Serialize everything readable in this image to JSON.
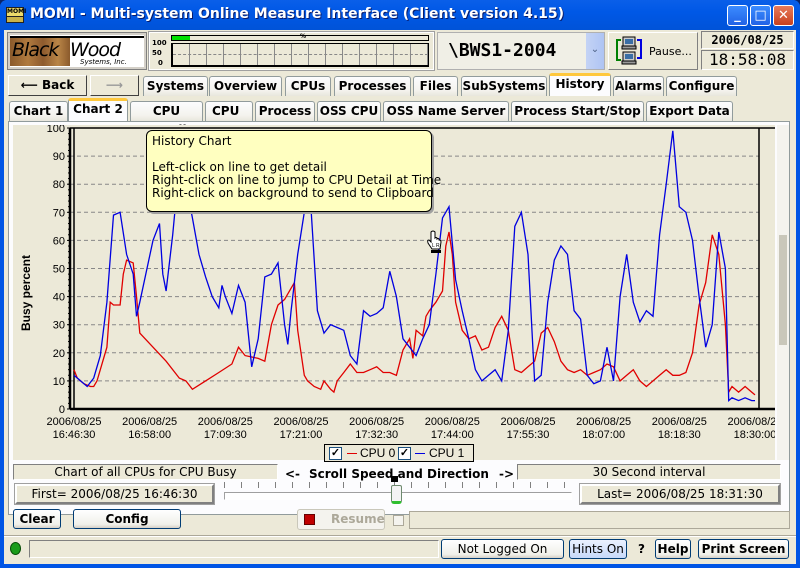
{
  "window": {
    "title": "MOMI - Multi-system Online Measure Interface (Client version 4.15)",
    "icon_label": "MOMI",
    "controls": [
      "minimize",
      "maximize",
      "close"
    ]
  },
  "header": {
    "logo": {
      "word1": "Black",
      "word2": "Wood",
      "word3": "Systems, Inc."
    },
    "mini_chart": {
      "pct_label": "%",
      "progress_percent": 7,
      "y_ticks": [
        "100",
        "50",
        "0"
      ]
    },
    "system_select": {
      "value": "\\BWS1-2004"
    },
    "pause_button": {
      "label": "Pause..."
    },
    "date": "2006/08/25",
    "time": "18:58:08"
  },
  "nav": {
    "back_label": "Back",
    "forward_label": "",
    "main_tabs": [
      {
        "label": "Systems",
        "active": false
      },
      {
        "label": "Overview",
        "active": false
      },
      {
        "label": "CPUs",
        "active": false
      },
      {
        "label": "Processes",
        "active": false
      },
      {
        "label": "Files",
        "active": false
      },
      {
        "label": "SubSystems",
        "active": false
      },
      {
        "label": "History",
        "active": true
      },
      {
        "label": "Alarms",
        "active": false
      },
      {
        "label": "Configure",
        "active": false
      }
    ],
    "sub_tabs": [
      {
        "label": "Chart 1",
        "active": false
      },
      {
        "label": "Chart 2",
        "active": true
      },
      {
        "label": "CPU Detail",
        "active": false
      },
      {
        "label": "CPU",
        "active": false
      },
      {
        "label": "Process",
        "active": false
      },
      {
        "label": "OSS CPU",
        "active": false
      },
      {
        "label": "OSS Name Server",
        "active": false
      },
      {
        "label": "Process Start/Stop",
        "active": false
      },
      {
        "label": "Export Data",
        "active": false
      }
    ]
  },
  "tooltip": {
    "title": "History Chart",
    "lines": [
      "Left-click on line to get detail",
      "Right-click on line to jump to CPU Detail at Time",
      "Right-click on background to send to Clipboard"
    ]
  },
  "chart_data": {
    "type": "line",
    "title": "",
    "xlabel": "",
    "ylabel": "Busy percent",
    "ylim": [
      0,
      100
    ],
    "y_ticks": [
      0,
      10,
      20,
      30,
      40,
      50,
      60,
      70,
      80,
      90,
      100
    ],
    "grid": "horizontal dashed",
    "x_ticks": [
      {
        "date": "2006/08/25",
        "time": "16:46:30"
      },
      {
        "date": "2006/08/25",
        "time": "16:58:00"
      },
      {
        "date": "2006/08/25",
        "time": "17:09:30"
      },
      {
        "date": "2006/08/25",
        "time": "17:21:00"
      },
      {
        "date": "2006/08/25",
        "time": "17:32:30"
      },
      {
        "date": "2006/08/25",
        "time": "17:44:00"
      },
      {
        "date": "2006/08/25",
        "time": "17:55:30"
      },
      {
        "date": "2006/08/25",
        "time": "18:07:00"
      },
      {
        "date": "2006/08/25",
        "time": "18:18:30"
      },
      {
        "date": "2006/08/25",
        "time": "18:30:00"
      }
    ],
    "x_unit": "minutes since 16:46:30",
    "xlim": [
      0,
      103.5
    ],
    "legend": "bottom-center",
    "series": [
      {
        "name": "CPU 0",
        "color": "#e00000",
        "checked": true,
        "points": [
          [
            0,
            14
          ],
          [
            0.5,
            11
          ],
          [
            1.5,
            9
          ],
          [
            2.5,
            8
          ],
          [
            3,
            8
          ],
          [
            3.5,
            10
          ],
          [
            4,
            14
          ],
          [
            5,
            22
          ],
          [
            5.5,
            38
          ],
          [
            6,
            37
          ],
          [
            7,
            37
          ],
          [
            7.5,
            48
          ],
          [
            8,
            53
          ],
          [
            9,
            52
          ],
          [
            9.5,
            40
          ],
          [
            10,
            27
          ],
          [
            12,
            22
          ],
          [
            14,
            17
          ],
          [
            16,
            11
          ],
          [
            17,
            10
          ],
          [
            18,
            7
          ],
          [
            20,
            10
          ],
          [
            22,
            13
          ],
          [
            24,
            16
          ],
          [
            25,
            22
          ],
          [
            26,
            19
          ],
          [
            28,
            18
          ],
          [
            29,
            17
          ],
          [
            30,
            30
          ],
          [
            31,
            37
          ],
          [
            32,
            39
          ],
          [
            33,
            43
          ],
          [
            33.5,
            45
          ],
          [
            34,
            28
          ],
          [
            35,
            12
          ],
          [
            35.5,
            10
          ],
          [
            36.5,
            8
          ],
          [
            37.5,
            7
          ],
          [
            38,
            10
          ],
          [
            39,
            7
          ],
          [
            39.5,
            6
          ],
          [
            40,
            10
          ],
          [
            41,
            13
          ],
          [
            42,
            16
          ],
          [
            43,
            13
          ],
          [
            44,
            13
          ],
          [
            45,
            14
          ],
          [
            46,
            15
          ],
          [
            47,
            13
          ],
          [
            48,
            13
          ],
          [
            49,
            12
          ],
          [
            50,
            21
          ],
          [
            51,
            25
          ],
          [
            51.5,
            18
          ],
          [
            52,
            28
          ],
          [
            53,
            26
          ],
          [
            53.5,
            33
          ],
          [
            54,
            35
          ],
          [
            55,
            38
          ],
          [
            56,
            42
          ],
          [
            56.5,
            58
          ],
          [
            57,
            63
          ],
          [
            57.5,
            55
          ],
          [
            58,
            38
          ],
          [
            59,
            28
          ],
          [
            60,
            25
          ],
          [
            61,
            26
          ],
          [
            62,
            21
          ],
          [
            63,
            22
          ],
          [
            64,
            29
          ],
          [
            65,
            33
          ],
          [
            66,
            28
          ],
          [
            67,
            14
          ],
          [
            68,
            13
          ],
          [
            69,
            15
          ],
          [
            70,
            17
          ],
          [
            71,
            27
          ],
          [
            72,
            29
          ],
          [
            73,
            24
          ],
          [
            74,
            17
          ],
          [
            75,
            14
          ],
          [
            76,
            13
          ],
          [
            77,
            14
          ],
          [
            78,
            12
          ],
          [
            79,
            13
          ],
          [
            80,
            14
          ],
          [
            81,
            16
          ],
          [
            82,
            15
          ],
          [
            83,
            10
          ],
          [
            84,
            12
          ],
          [
            85,
            14
          ],
          [
            86,
            10
          ],
          [
            87,
            8
          ],
          [
            88,
            10
          ],
          [
            89,
            12
          ],
          [
            90,
            14
          ],
          [
            91,
            12
          ],
          [
            92,
            12
          ],
          [
            93,
            13
          ],
          [
            94,
            20
          ],
          [
            95,
            37
          ],
          [
            96,
            45
          ],
          [
            97,
            62
          ],
          [
            98,
            55
          ],
          [
            99,
            30
          ],
          [
            99.5,
            6
          ],
          [
            100,
            8
          ],
          [
            101,
            6
          ],
          [
            102,
            8
          ],
          [
            103,
            6
          ],
          [
            103.5,
            5
          ]
        ]
      },
      {
        "name": "CPU 1",
        "color": "#0000e0",
        "checked": true,
        "points": [
          [
            0,
            12
          ],
          [
            1,
            10
          ],
          [
            2,
            8
          ],
          [
            3,
            11
          ],
          [
            4,
            19
          ],
          [
            5,
            38
          ],
          [
            6,
            69
          ],
          [
            7,
            70
          ],
          [
            8,
            55
          ],
          [
            9,
            48
          ],
          [
            9.5,
            33
          ],
          [
            10,
            38
          ],
          [
            11,
            49
          ],
          [
            12,
            60
          ],
          [
            13,
            66
          ],
          [
            13.5,
            48
          ],
          [
            14,
            42
          ],
          [
            15,
            62
          ],
          [
            16,
            87
          ],
          [
            17,
            80
          ],
          [
            18,
            68
          ],
          [
            19,
            55
          ],
          [
            20,
            47
          ],
          [
            21,
            40
          ],
          [
            22,
            36
          ],
          [
            22.5,
            44
          ],
          [
            23,
            40
          ],
          [
            24,
            34
          ],
          [
            25,
            44
          ],
          [
            26,
            38
          ],
          [
            27,
            15
          ],
          [
            28,
            25
          ],
          [
            29,
            47
          ],
          [
            30,
            48
          ],
          [
            31,
            52
          ],
          [
            32,
            30
          ],
          [
            32.5,
            23
          ],
          [
            33,
            35
          ],
          [
            34,
            55
          ],
          [
            35,
            70
          ],
          [
            36,
            72
          ],
          [
            37,
            35
          ],
          [
            38,
            27
          ],
          [
            39,
            30
          ],
          [
            40,
            29
          ],
          [
            41,
            28
          ],
          [
            42,
            19
          ],
          [
            43,
            16
          ],
          [
            44,
            35
          ],
          [
            45,
            33
          ],
          [
            46,
            34
          ],
          [
            47,
            36
          ],
          [
            48,
            49
          ],
          [
            49,
            40
          ],
          [
            50,
            25
          ],
          [
            51,
            22
          ],
          [
            52,
            19
          ],
          [
            53,
            25
          ],
          [
            54,
            30
          ],
          [
            55,
            48
          ],
          [
            56,
            68
          ],
          [
            57,
            72
          ],
          [
            58,
            46
          ],
          [
            59,
            35
          ],
          [
            60,
            25
          ],
          [
            61,
            14
          ],
          [
            62,
            10
          ],
          [
            63,
            12
          ],
          [
            64,
            14
          ],
          [
            65,
            10
          ],
          [
            66,
            28
          ],
          [
            67,
            65
          ],
          [
            68,
            70
          ],
          [
            69,
            55
          ],
          [
            70,
            10
          ],
          [
            71,
            12
          ],
          [
            72,
            38
          ],
          [
            73,
            53
          ],
          [
            74,
            58
          ],
          [
            75,
            55
          ],
          [
            76,
            35
          ],
          [
            77,
            32
          ],
          [
            78,
            12
          ],
          [
            79,
            9
          ],
          [
            80,
            10
          ],
          [
            81,
            22
          ],
          [
            82,
            10
          ],
          [
            83,
            40
          ],
          [
            84,
            55
          ],
          [
            85,
            38
          ],
          [
            86,
            31
          ],
          [
            87,
            35
          ],
          [
            88,
            33
          ],
          [
            89,
            62
          ],
          [
            90,
            80
          ],
          [
            91,
            99
          ],
          [
            92,
            72
          ],
          [
            93,
            70
          ],
          [
            94,
            60
          ],
          [
            95,
            40
          ],
          [
            96,
            22
          ],
          [
            97,
            30
          ],
          [
            98,
            63
          ],
          [
            99,
            50
          ],
          [
            99.5,
            3
          ],
          [
            100,
            4
          ],
          [
            101,
            3
          ],
          [
            102,
            4
          ],
          [
            103,
            3
          ],
          [
            103.5,
            3
          ]
        ]
      }
    ]
  },
  "controls": {
    "chart_desc": "Chart of all CPUs for CPU Busy",
    "scroll_left": "<-",
    "scroll_label": "Scroll Speed  and Direction",
    "scroll_right": "->",
    "interval": "30 Second interval",
    "first": "First= 2006/08/25 16:46:30",
    "last": "Last= 2006/08/25 18:31:30",
    "scroll_speed_value": 0,
    "clear_label": "Clear",
    "config_label": "Config",
    "resume_label": "Resume"
  },
  "statusbar": {
    "status_text": "",
    "login_label": "Not Logged On",
    "hints_label": "Hints On",
    "question_label": "?",
    "help_label": "Help",
    "print_label": "Print Screen"
  }
}
